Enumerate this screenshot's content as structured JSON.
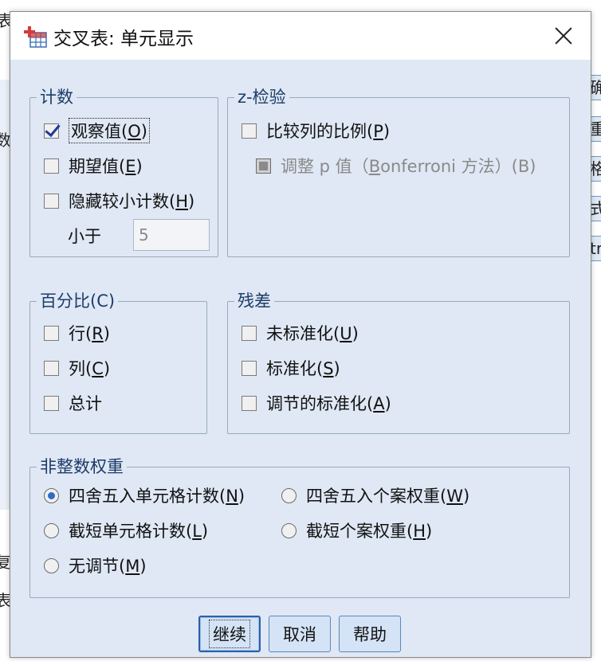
{
  "background": {
    "left_glyphs": [
      "表",
      "数",
      "复",
      "表"
    ],
    "right_tabs": [
      "确",
      "重",
      "格",
      "式",
      "tr"
    ]
  },
  "dialog": {
    "title": "交叉表: 单元显示",
    "icon": "spss-crosstab-icon",
    "close_icon": "close-x-icon"
  },
  "counts": {
    "legend": "计数",
    "observed": {
      "text": "观察值",
      "key": "O",
      "checked": true
    },
    "expected": {
      "text": "期望值",
      "key": "E",
      "checked": false
    },
    "hide_small": {
      "text": "隐藏较小计数",
      "key": "H",
      "checked": false
    },
    "less_than_label": "小于",
    "less_than_value": "5"
  },
  "ztest": {
    "legend": "z-检验",
    "compare": {
      "text": "比较列的比例",
      "key": "P",
      "checked": false
    },
    "adjust": {
      "text_before": "调整 p 值（",
      "key": "B",
      "text_after": "onferroni 方法）(B)",
      "checked": false,
      "disabled": true
    }
  },
  "percent": {
    "legend": "百分比(C)",
    "row": {
      "text": "行",
      "key": "R",
      "checked": false
    },
    "col": {
      "text": "列",
      "key": "C",
      "checked": false
    },
    "total": {
      "text": "总计",
      "checked": false
    }
  },
  "residuals": {
    "legend": "残差",
    "unstd": {
      "text": "未标准化",
      "key": "U",
      "checked": false
    },
    "std": {
      "text": "标准化",
      "key": "S",
      "checked": false
    },
    "adj": {
      "text": "调节的标准化",
      "key": "A",
      "checked": false
    }
  },
  "noninteger": {
    "legend": "非整数权重",
    "round_cell": {
      "text": "四舍五入单元格计数",
      "key": "N",
      "selected": true
    },
    "round_case": {
      "text": "四舍五入个案权重",
      "key": "W",
      "selected": false
    },
    "trunc_cell": {
      "text": "截短单元格计数",
      "key": "L",
      "selected": false
    },
    "trunc_case": {
      "text": "截短个案权重",
      "key": "H",
      "selected": false
    },
    "no_adjust": {
      "text": "无调节",
      "key": "M",
      "selected": false
    }
  },
  "buttons": {
    "continue": "继续",
    "cancel": "取消",
    "help": "帮助"
  },
  "colors": {
    "client_bg": "#dfe8f4",
    "group_border": "#98aac0",
    "button_bg": "#d4e3f5",
    "button_border": "#5c86bd",
    "radio_selected": "#2d6bc9",
    "check_mark": "#1e3a9a"
  }
}
